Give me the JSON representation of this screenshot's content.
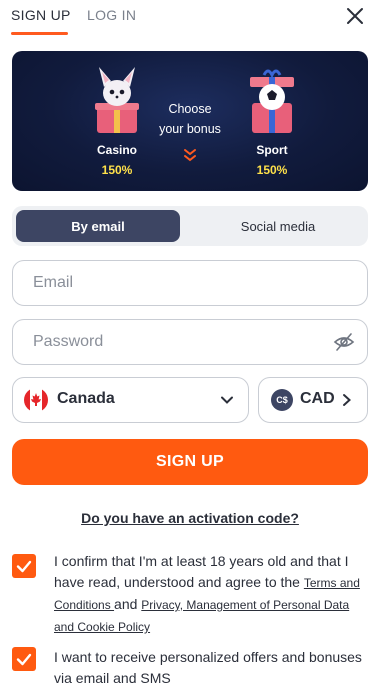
{
  "tabs": {
    "signup": "SIGN UP",
    "login": "LOG IN"
  },
  "banner": {
    "casino": {
      "title": "Casino",
      "value": "150%"
    },
    "choose_line1": "Choose",
    "choose_line2": "your bonus",
    "sport": {
      "title": "Sport",
      "value": "150%"
    }
  },
  "method_toggle": {
    "email": "By email",
    "social": "Social media",
    "selected": "By email"
  },
  "form": {
    "email_placeholder": "Email",
    "password_placeholder": "Password",
    "country": "Canada",
    "currency_code": "CAD",
    "currency_symbol": "C$"
  },
  "signup_button": "SIGN UP",
  "activation_link": "Do you have an activation code?",
  "consents": {
    "age_text": "I confirm that I'm at least 18 years old and that I have read, understood and agree to the ",
    "terms_link": "Terms and Conditions ",
    "and": "and ",
    "privacy_link": "Privacy, Management of Personal Data and Cookie Policy",
    "offers_text": "I want to receive personalized offers and bonuses via email and SMS"
  },
  "colors": {
    "accent": "#ff5a10",
    "dark": "#3d4563",
    "banner_bg": "#111b3d",
    "bonus_yellow": "#ffe14a"
  }
}
